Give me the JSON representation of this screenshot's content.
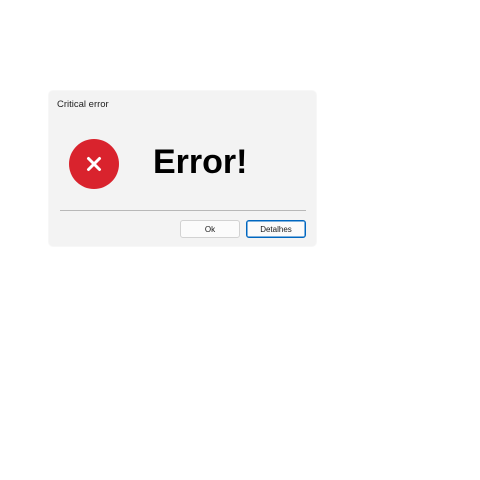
{
  "window": {
    "title": "Critical error"
  },
  "message": {
    "heading": "Error!",
    "icon": "error-x-circle-icon",
    "icon_color": "#d9232d"
  },
  "buttons": {
    "ok_label": "Ok",
    "details_label": "Detalhes"
  },
  "colors": {
    "dialog_background": "#f3f3f3",
    "focus_border": "#0067c0"
  }
}
